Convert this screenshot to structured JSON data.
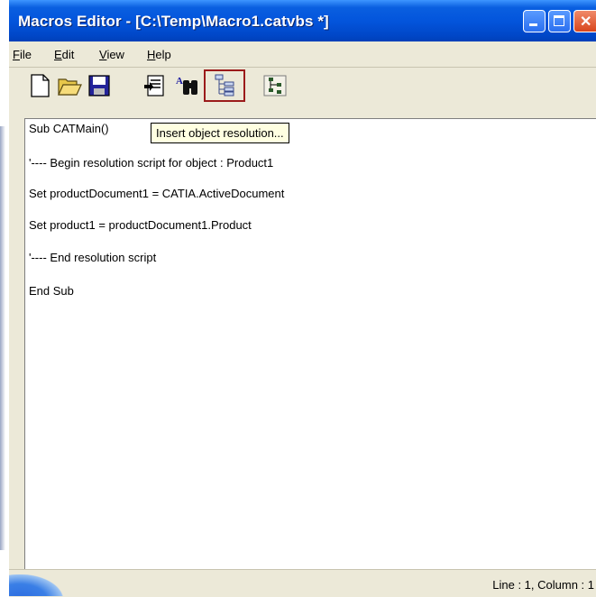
{
  "window": {
    "title": "Macros Editor - [C:\\Temp\\Macro1.catvbs *]"
  },
  "menu": {
    "items": [
      {
        "label": "File",
        "mnemonic": "F",
        "rest": "ile"
      },
      {
        "label": "Edit",
        "mnemonic": "E",
        "rest": "dit"
      },
      {
        "label": "View",
        "mnemonic": "V",
        "rest": "iew"
      },
      {
        "label": "Help",
        "mnemonic": "H",
        "rest": "elp"
      }
    ]
  },
  "toolbar": {
    "buttons": [
      "new-file-icon",
      "open-folder-icon",
      "save-disk-icon",
      "insert-text-icon",
      "find-binoculars-icon",
      "insert-object-resolution-icon",
      "object-browser-icon"
    ],
    "highlighted": "insert-object-resolution-icon",
    "highlight_color": "#9b1b1b"
  },
  "tooltip": {
    "text": "Insert object resolution..."
  },
  "editor": {
    "lines": [
      "Sub CATMain()",
      "'---- Begin resolution script for object : Product1",
      "Set productDocument1 = CATIA.ActiveDocument",
      "Set product1 = productDocument1.Product",
      "'---- End resolution script",
      "End Sub"
    ]
  },
  "status": {
    "position": "Line : 1, Column : 1"
  },
  "colors": {
    "titlebar": "#0355dc",
    "chrome": "#ece9d8",
    "tooltip_bg": "#ffffe1"
  }
}
